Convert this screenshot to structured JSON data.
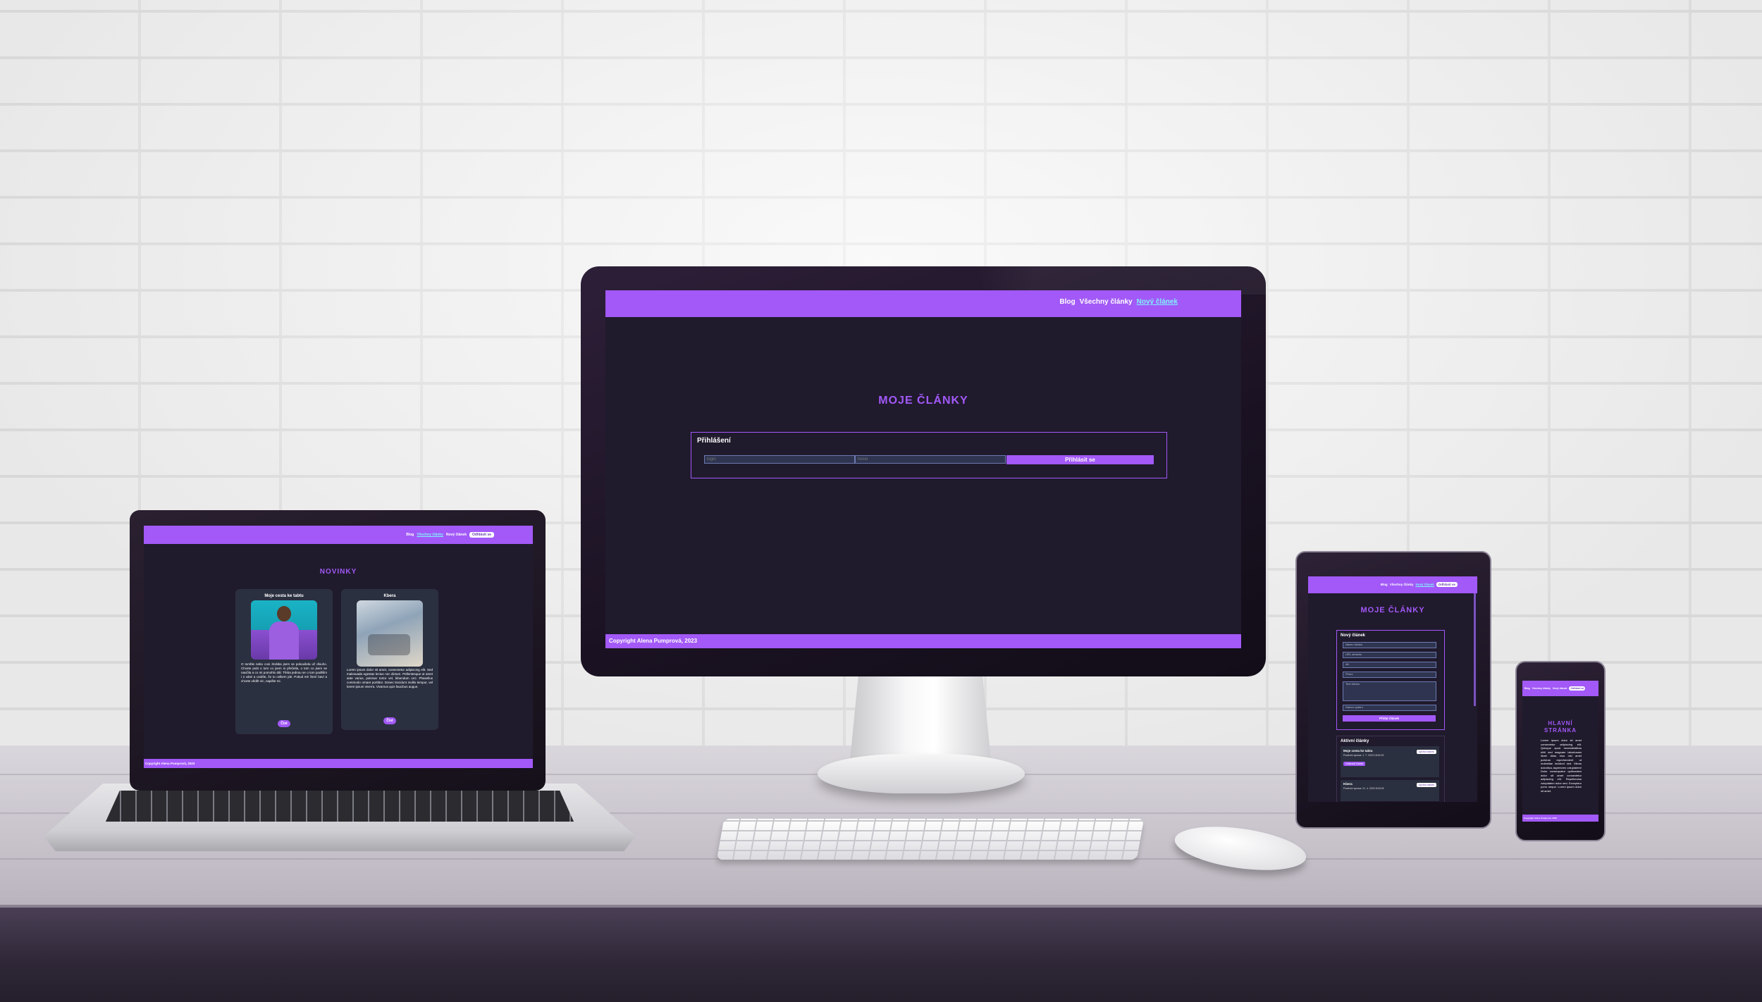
{
  "site": {
    "nav_blog": "Blog",
    "nav_all": "Všechny články",
    "nav_new": "Nový článek",
    "nav_login_btn": "Odhlásit se",
    "footer": "Copyright Alena Pumprová, 2023"
  },
  "monitor": {
    "title": "MOJE ČLÁNKY",
    "login_heading": "Přihlášení",
    "login_placeholder": "login",
    "password_placeholder": "heslo",
    "submit": "Přihlásit se"
  },
  "laptop": {
    "title": "NOVINKY",
    "cards": [
      {
        "title": "Moje cesta ke tabtu",
        "text": "O tomhle nebo cosi zkrátka jsem se pokoušela už dlouho. Chcete psát o tom co jsem si přečetla, o tom co jsem se naučila a co mi pomohlo dál. Třeba jednou se o tom podělím i s vámi a uvidíte, že to celkem jde. Pokud mé čtení baví a chcete vědět víc, napište mi.",
        "button": "Číst"
      },
      {
        "title": "Kbera",
        "text": "Lorem ipsum dolor sit amet, consectetur adipiscing elit. Sed malesuada egestas lectus nec dictum. Pellentesque ut amet ante varius, pulvinar tortor vel, bibendum orci. Phasellus commodo ornare porttitor. Donec tincidunt mollis tempor, vel lorem ipsum viverra. Vivamus quis faucibus augue.",
        "button": "Číst"
      }
    ]
  },
  "tablet": {
    "title": "MOJE ČLÁNKY",
    "form_heading": "Nový článek",
    "fields": [
      "Název článku",
      "URL obrázku",
      "Alt",
      "Perex",
      "Text článku",
      "Datum vydání"
    ],
    "form_submit": "Přidat článek",
    "active_heading": "Aktivní články",
    "articles": [
      {
        "title": "Moje cesta ke tabtu",
        "meta": "Poslední úprava: 1. 7. 2023 18:52:29",
        "edit": "Upravit článek",
        "delete": "Odstranit článek"
      },
      {
        "title": "Kbera",
        "meta": "Poslední úprava: 21. 4. 2023 8:00:05",
        "edit": "Upravit článek"
      }
    ]
  },
  "phone": {
    "title": "HLAVNÍ STRÁNKA",
    "text": "Lorem ipsum dolor sit amet consectetur adipiscing elit. Quisque quod necessitatibus nihil sed magnam laboriosam illum! Alias eius nisl amet pulvinar reprehenderit ut molestiae incidunt sed. Minus doloribus asperiores voluptatem! Dolor consequatur quibusdam dolor sit amet consectetur adipiscing elit. Repellendus voluptatem dolor sed. Excepteur porro neque. Lorem ipsum dolor sit amet."
  }
}
